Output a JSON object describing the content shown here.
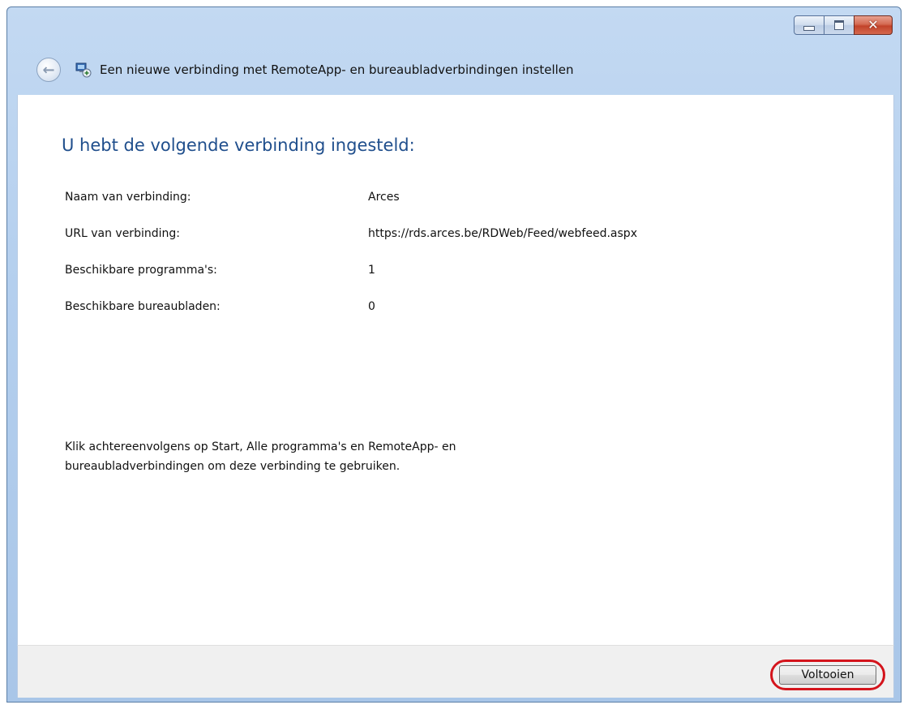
{
  "window": {
    "title": "Een nieuwe verbinding met RemoteApp- en bureaubladverbindingen instellen",
    "caption_buttons": {
      "minimize_icon": "minimize-icon",
      "maximize_icon": "maximize-icon",
      "close_icon": "close-icon",
      "close_glyph": "✕"
    },
    "back_glyph": "←",
    "app_icon": "remoteapp-connection-icon"
  },
  "main": {
    "heading": "U hebt de volgende verbinding ingesteld:",
    "rows": [
      {
        "label": "Naam van verbinding:",
        "value": "Arces"
      },
      {
        "label": "URL van verbinding:",
        "value": "https://rds.arces.be/RDWeb/Feed/webfeed.aspx"
      },
      {
        "label": "Beschikbare programma's:",
        "value": "1"
      },
      {
        "label": "Beschikbare bureaubladen:",
        "value": "0"
      }
    ],
    "instruction": "Klik achtereenvolgens op Start, Alle programma's en RemoteApp- en bureaubladverbindingen om deze verbinding te gebruiken."
  },
  "footer": {
    "finish_label": "Voltooien"
  },
  "colors": {
    "heading": "#1f4e8c",
    "highlight": "#d4141c",
    "titlebar": "#b4cfee"
  }
}
